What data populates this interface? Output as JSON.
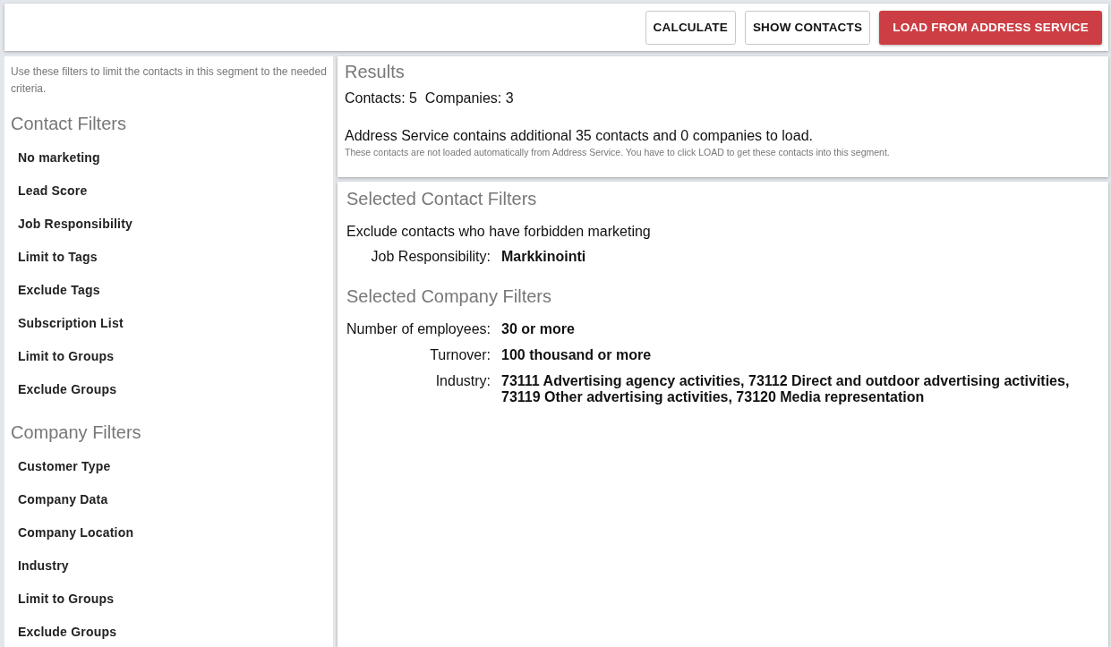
{
  "toolbar": {
    "buttons": [
      {
        "label": "CALCULATE",
        "kind": "outlined"
      },
      {
        "label": "SHOW CONTACTS",
        "kind": "outlined"
      },
      {
        "label": "LOAD FROM ADDRESS SERVICE",
        "kind": "primary"
      }
    ]
  },
  "sidebar": {
    "intro": "Use these filters to limit the contacts in this segment to the needed criteria.",
    "sections": [
      {
        "title": "Contact Filters",
        "items": [
          "No marketing",
          "Lead Score",
          "Job Responsibility",
          "Limit to Tags",
          "Exclude Tags",
          "Subscription List",
          "Limit to Groups",
          "Exclude Groups"
        ]
      },
      {
        "title": "Company Filters",
        "items": [
          "Customer Type",
          "Company Data",
          "Company Location",
          "Industry",
          "Limit to Groups",
          "Exclude Groups"
        ]
      }
    ]
  },
  "results": {
    "title": "Results",
    "contacts": "Contacts: 5",
    "companies": "Companies: 3",
    "address_service": "Address Service contains additional 35 contacts and 0 companies to load.",
    "note": "These contacts are not loaded automatically from Address Service. You have to click LOAD to get these contacts into this segment."
  },
  "selected_contact_filters": {
    "title": "Selected Contact Filters",
    "statement": "Exclude contacts who have forbidden marketing",
    "rows": [
      {
        "label": "Job Responsibility:",
        "value": "Markkinointi"
      }
    ]
  },
  "selected_company_filters": {
    "title": "Selected Company Filters",
    "rows": [
      {
        "label": "Number of employees:",
        "value": "30 or more"
      },
      {
        "label": "Turnover:",
        "value": "100 thousand or more"
      },
      {
        "label": "Industry:",
        "value": "73111 Advertising agency activities, 73112 Direct and outdoor advertising activities, 73119 Other advertising activities, 73120 Media representation"
      }
    ]
  }
}
